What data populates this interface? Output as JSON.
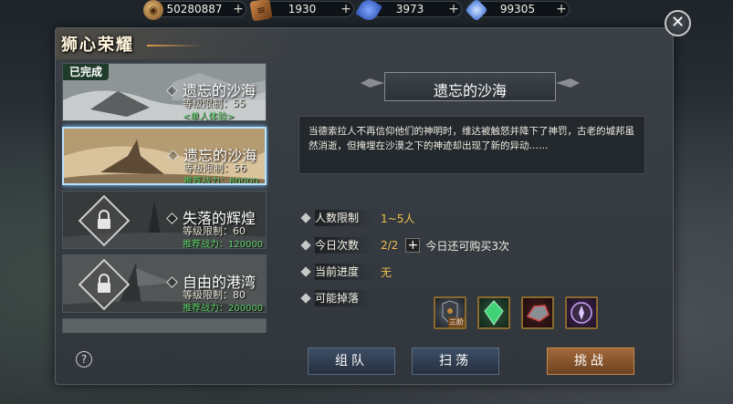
{
  "resources": [
    {
      "icon": "gold-coin-icon",
      "value": "50280887"
    },
    {
      "icon": "scroll-icon",
      "value": "1930"
    },
    {
      "icon": "blue-feather-icon",
      "value": "3973"
    },
    {
      "icon": "blue-crystal-icon",
      "value": "99305"
    }
  ],
  "resource_plus": "+",
  "panel": {
    "title": "狮心荣耀",
    "close": "✕"
  },
  "stages": [
    {
      "name": "遗忘的沙海",
      "level": "等级限制：55",
      "extra": "<单人体验>",
      "tag": "已完成"
    },
    {
      "name": "遗忘的沙海",
      "level": "等级限制：56",
      "extra": "推荐战力：80000"
    },
    {
      "name": "失落的辉煌",
      "level": "等级限制：60",
      "extra": "推荐战力：120000"
    },
    {
      "name": "自由的港湾",
      "level": "等级限制：80",
      "extra": "推荐战力：200000"
    }
  ],
  "detail": {
    "title": "遗忘的沙海",
    "description": "当德索拉人不再信仰他们的神明时，维达被触怒并降下了神罚，古老的城邦虽然消逝，但掩埋在沙漠之下的神迹却出现了新的异动……",
    "rows": {
      "party": {
        "label": "人数限制",
        "value": "1~5人"
      },
      "daily": {
        "label": "今日次数",
        "value": "2/2",
        "plus": "+",
        "buy": "今日还可购买3次"
      },
      "progress": {
        "label": "当前进度",
        "value": "无"
      },
      "drops": {
        "label": "可能掉落"
      }
    },
    "drops": [
      {
        "icon": "dark-armor-icon",
        "tier": "三阶"
      },
      {
        "icon": "green-crystal-icon"
      },
      {
        "icon": "red-ore-icon"
      },
      {
        "icon": "purple-emblem-icon"
      }
    ]
  },
  "footer": {
    "help": "?",
    "team": "组队",
    "sweep": "扫荡",
    "challenge": "挑战"
  }
}
